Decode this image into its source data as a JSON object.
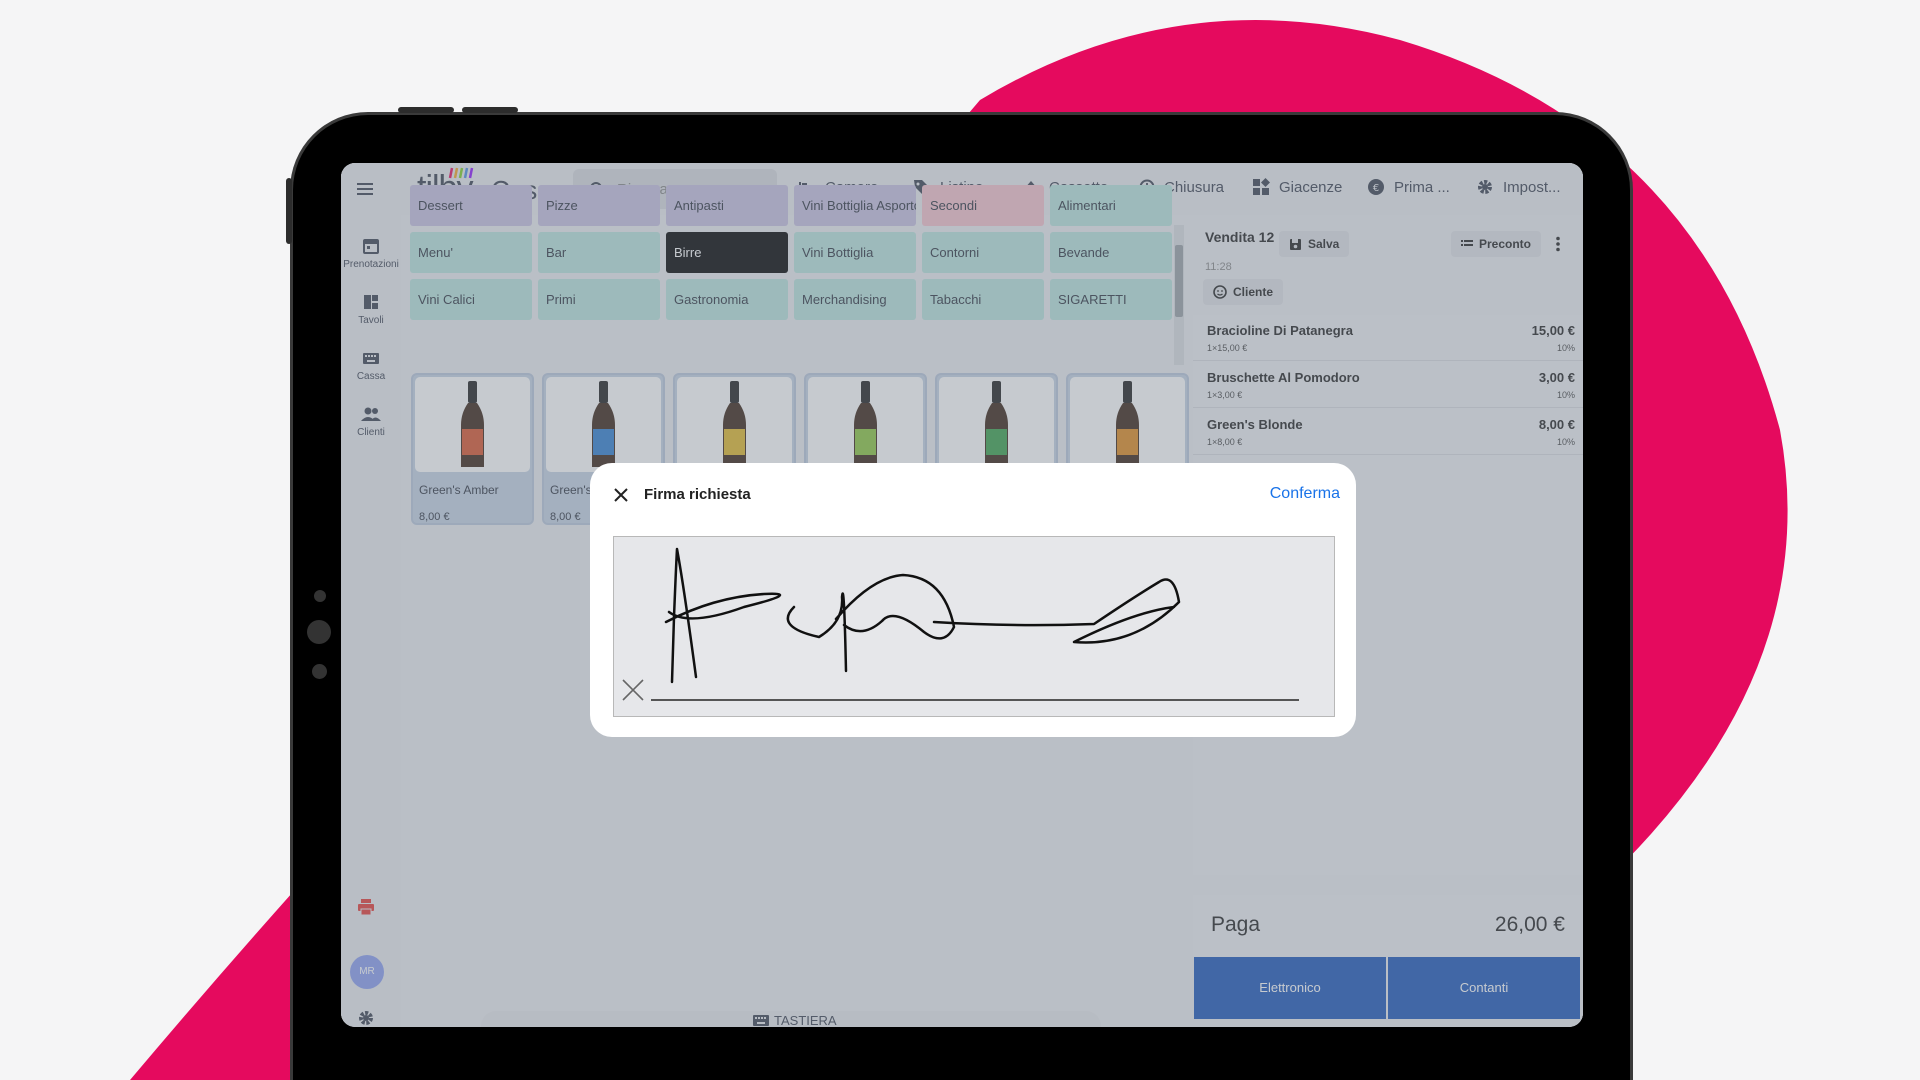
{
  "brand": {
    "logo": "tilby",
    "app_title": "Cassa",
    "accent": "#e50a5e",
    "primary": "#1a55b8"
  },
  "search": {
    "placeholder": "Ricerca"
  },
  "nav": [
    {
      "label": "Camere",
      "icon": "bed-icon"
    },
    {
      "label": "Listino",
      "icon": "tag-icon"
    },
    {
      "label": "Cassetto",
      "icon": "eject-icon"
    },
    {
      "label": "Chiusura",
      "icon": "history-icon"
    },
    {
      "label": "Giacenze",
      "icon": "widgets-icon"
    },
    {
      "label": "Prima ...",
      "icon": "coin-icon"
    },
    {
      "label": "Impost...",
      "icon": "gear-icon"
    }
  ],
  "sidebar": [
    {
      "label": "Prenotazioni",
      "icon": "calendar-icon"
    },
    {
      "label": "Tavoli",
      "icon": "tables-icon"
    },
    {
      "label": "Cassa",
      "icon": "keyboard-icon"
    },
    {
      "label": "Clienti",
      "icon": "people-icon"
    }
  ],
  "user": {
    "initials": "MR"
  },
  "categories": [
    {
      "label": "Dessert",
      "color": "#c7bfe0"
    },
    {
      "label": "Pizze",
      "color": "#c7bfe0"
    },
    {
      "label": "Antipasti",
      "color": "#c7bfe0"
    },
    {
      "label": "Vini Bottiglia Asporto",
      "color": "#c7bfe0"
    },
    {
      "label": "Secondi",
      "color": "#f5c1cc"
    },
    {
      "label": "Alimentari",
      "color": "#b8e3dd"
    },
    {
      "label": "Menu'",
      "color": "#b8e3dd"
    },
    {
      "label": "Bar",
      "color": "#b8e3dd"
    },
    {
      "label": "Birre",
      "color": "#000000",
      "selected": true
    },
    {
      "label": "Vini Bottiglia",
      "color": "#b8e3dd"
    },
    {
      "label": "Contorni",
      "color": "#b8e3dd"
    },
    {
      "label": "Bevande",
      "color": "#b8e3dd"
    },
    {
      "label": "Vini Calici",
      "color": "#b8e3dd"
    },
    {
      "label": "Primi",
      "color": "#b8e3dd"
    },
    {
      "label": "Gastronomia",
      "color": "#b8e3dd"
    },
    {
      "label": "Merchandising",
      "color": "#b8e3dd"
    },
    {
      "label": "Tabacchi",
      "color": "#b8e3dd"
    },
    {
      "label": "SIGARETTI",
      "color": "#b8e3dd"
    }
  ],
  "products": [
    {
      "name": "Green's Amber",
      "price": "8,00 €",
      "label_color": "#d9532b"
    },
    {
      "name": "Green's",
      "price": "8,00 €",
      "label_color": "#2f7fd0"
    },
    {
      "name": "",
      "price": "",
      "label_color": "#e2b82a"
    },
    {
      "name": "",
      "price": "",
      "label_color": "#8cc63f"
    },
    {
      "name": "",
      "price": "",
      "label_color": "#3aa04a"
    },
    {
      "name": "",
      "price": "",
      "label_color": "#e08a1e"
    }
  ],
  "sale": {
    "title": "Vendita 12",
    "save_label": "Salva",
    "preconto_label": "Preconto",
    "time": "11:28",
    "customer_label": "Cliente",
    "items": [
      {
        "name": "Bracioline Di Patanegra",
        "qty": "1×15,00 €",
        "total": "15,00 €",
        "vat": "10%"
      },
      {
        "name": "Bruschette Al Pomodoro",
        "qty": "1×3,00 €",
        "total": "3,00 €",
        "vat": "10%"
      },
      {
        "name": "Green's Blonde",
        "qty": "1×8,00 €",
        "total": "8,00 €",
        "vat": "10%"
      }
    ],
    "pay_label": "Paga",
    "pay_total": "26,00 €",
    "btn_electronic": "Elettronico",
    "btn_cash": "Contanti"
  },
  "keyboard_label": "TASTIERA",
  "modal": {
    "title": "Firma richiesta",
    "confirm_label": "Conferma"
  }
}
